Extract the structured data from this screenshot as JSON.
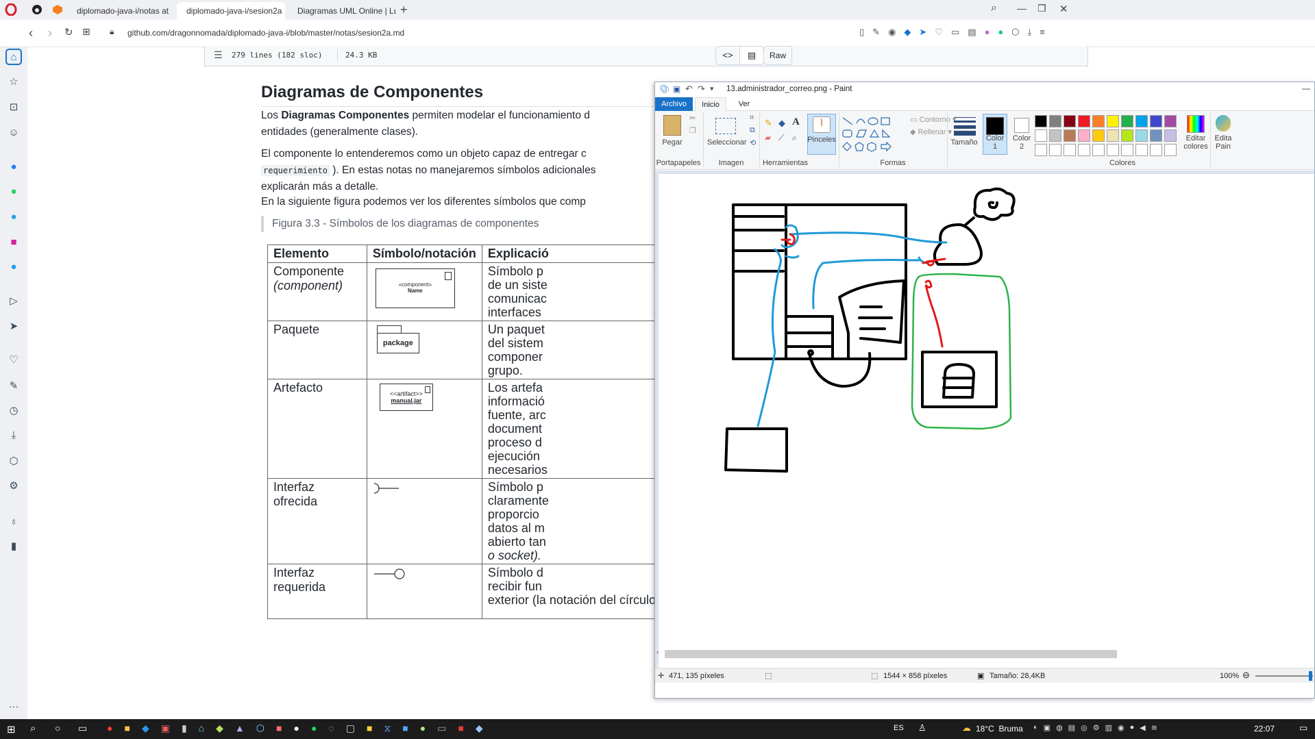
{
  "browser": {
    "tabs": [
      {
        "label": "diplomado-java-i/notas at",
        "active": false
      },
      {
        "label": "diplomado-java-i/sesion2a",
        "active": true
      },
      {
        "label": "Diagramas UML Online | Lu",
        "active": false
      }
    ],
    "url": "github.com/dragonnomada/diplomado-java-i/blob/master/notas/sesion2a.md"
  },
  "file": {
    "lines": "279 lines (182 sloc)",
    "size": "24.3 KB",
    "raw": "Raw",
    "blame": "Blame"
  },
  "doc": {
    "heading": "Diagramas de Componentes",
    "p1_pre": "Los ",
    "p1_bold": "Diagramas Componentes",
    "p1_post": " permiten modelar el funcionamiento d",
    "p1_line2": "entidades (generalmente clases).",
    "p2_line1": "El componente lo entenderemos como un objeto capaz de entregar c",
    "p2_code": "requerimiento",
    "p2_line2_post": " ). En estas notas no manejaremos símbolos adicionales",
    "p2_line3": "explicarán más a detalle.",
    "p3": "En la siguiente figura podemos ver los diferentes símbolos que comp",
    "figure_caption": "Figura 3.3 - Símbolos de los diagramas de componentes"
  },
  "table": {
    "headers": [
      "Elemento",
      "Símbolo/notación",
      "Explicació"
    ],
    "rows": [
      {
        "element": "Componente",
        "element2": "(component)",
        "expl": [
          "Símbolo p",
          "de un siste",
          "comunicac",
          "interfaces"
        ],
        "symbol": {
          "stereo": "«component»",
          "name": "Name"
        }
      },
      {
        "element": "Paquete",
        "element2": "",
        "expl": [
          "Un paquet",
          "del sistem",
          "componer",
          "grupo."
        ],
        "symbol": {
          "name": "package"
        }
      },
      {
        "element": "Artefacto",
        "element2": "",
        "expl": [
          "Los artefa",
          "informació",
          "fuente, arc",
          "document",
          "proceso d",
          "ejecución",
          "necesarios"
        ],
        "symbol": {
          "stereo": "<<artifact>>",
          "name": "manual.jar"
        }
      },
      {
        "element": "Interfaz ofrecida",
        "element2": "",
        "expl": [
          "Símbolo p",
          "claramente",
          "proporcio",
          "datos al m",
          "abierto tan",
          "o socket)."
        ]
      },
      {
        "element": "Interfaz requerida",
        "element2": "",
        "expl": [
          "Símbolo d",
          "recibir fun",
          "exterior (la notación del círculo con"
        ]
      }
    ]
  },
  "paint": {
    "title": "13.administrador_correo.png - Paint",
    "tabs": [
      "Archivo",
      "Inicio",
      "Ver"
    ],
    "groups": [
      "Portapapeles",
      "Imagen",
      "Herramientas",
      "Formas",
      "Colores"
    ],
    "labels": {
      "paste": "Pegar",
      "select": "Seleccionar",
      "brushes": "Pinceles",
      "outline": "Contorno",
      "fill": "Rellenar",
      "size": "Tamaño",
      "color1": "Color 1",
      "color2": "Color 2",
      "edit_colors": "Editar colores",
      "edit_paint3d": "Edita Pain"
    },
    "palette_row1": [
      "#000000",
      "#7f7f7f",
      "#880015",
      "#ed1c24",
      "#ff7f27",
      "#fff200",
      "#22b14c",
      "#00a2e8",
      "#3f48cc",
      "#a349a4"
    ],
    "palette_row2": [
      "#ffffff",
      "#c3c3c3",
      "#b97a57",
      "#ffaec9",
      "#ffc90e",
      "#efe4b0",
      "#b5e61d",
      "#99d9ea",
      "#7092be",
      "#c8bfe7"
    ],
    "status": {
      "cursor": "471, 135 píxeles",
      "dimensions": "1544 × 858 píxeles",
      "size": "Tamaño: 28,4KB",
      "zoom": "100%"
    }
  },
  "taskbar": {
    "lang": "ES",
    "weather": "18°C  Bruma",
    "time": "22:07"
  },
  "colors": {
    "sketch_black": "#000000",
    "sketch_blue": "#1e9ad6",
    "sketch_red": "#e01b1b",
    "sketch_green": "#2db34a",
    "paint_accent": "#1a73c7"
  }
}
